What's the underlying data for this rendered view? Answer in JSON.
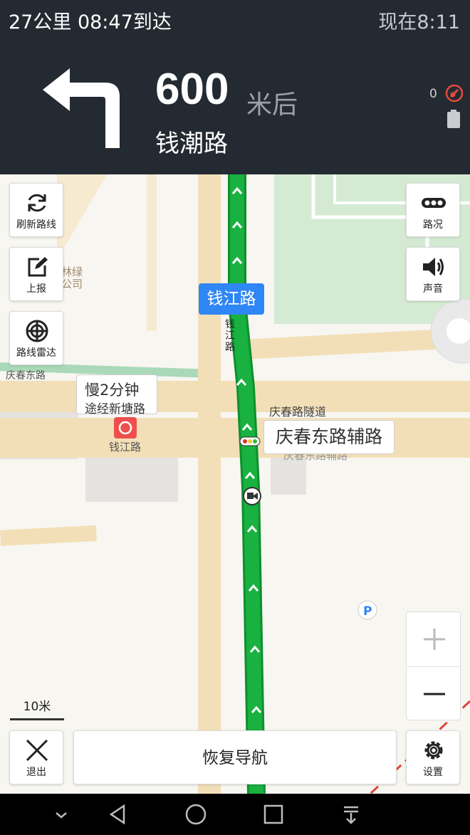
{
  "status_bar": {
    "trip_info": "27公里  08:47到达",
    "current_time": "现在8:11"
  },
  "guidance": {
    "maneuver_icon": "turn-left-arrow",
    "distance": "600",
    "distance_unit": "米后",
    "next_road": "钱潮路",
    "gps_satellites": "0"
  },
  "map": {
    "current_road_tag": "钱江路",
    "route_road_label": "钱江路",
    "route_road_label_chars": [
      "钱",
      "江",
      "路"
    ],
    "traffic_callout": {
      "line1": "慢2分钟",
      "line2": "途经新塘路"
    },
    "road_callout": "庆春东路辅路",
    "labels": {
      "left_road": "庆春东路",
      "tunnel": "庆春路隧道",
      "poi_station": "钱江路",
      "poi_partial_1": "林绿",
      "poi_partial_2": "公司",
      "under_callout": "庆春东路辅路"
    },
    "scale_label": "10米",
    "route_color": "#19b140",
    "accent_color": "#2f86f5"
  },
  "controls": {
    "refresh_route": "刷新路线",
    "report": "上报",
    "route_radar": "路线雷达",
    "traffic": "路况",
    "sound": "声音",
    "exit": "退出",
    "settings": "设置",
    "resume_nav": "恢复导航",
    "zoom_in_icon": "plus-icon",
    "zoom_out_icon": "minus-icon"
  },
  "system_nav": {
    "icons": [
      "chevron-down-icon",
      "back-icon",
      "home-icon",
      "recents-icon",
      "notification-pull-icon"
    ]
  }
}
